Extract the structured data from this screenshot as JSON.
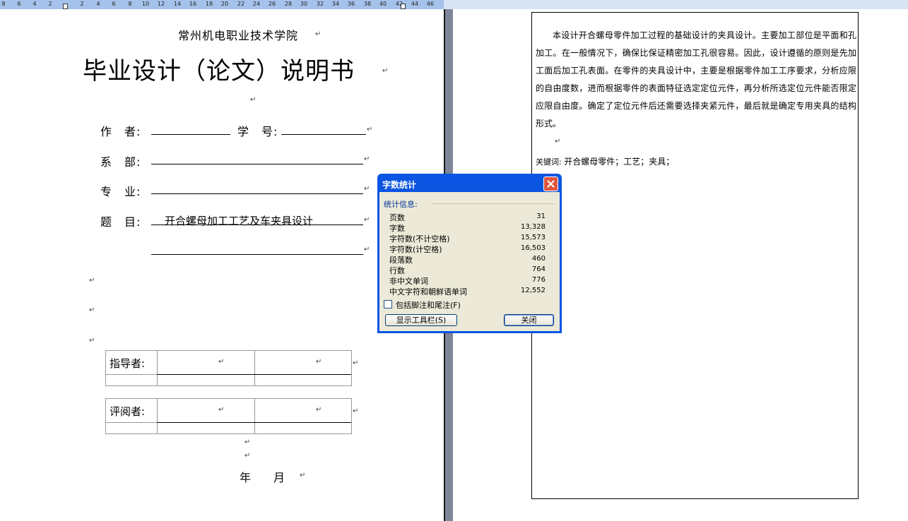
{
  "ruler": {
    "ticks": [
      "8",
      "6",
      "4",
      "2",
      "2",
      "4",
      "6",
      "8",
      "10",
      "12",
      "14",
      "16",
      "18",
      "20",
      "22",
      "24",
      "26",
      "28",
      "30",
      "32",
      "34",
      "36",
      "38",
      "40",
      "42",
      "44",
      "46"
    ]
  },
  "doc_left": {
    "college": "常州机电职业技术学院",
    "title": "毕业设计（论文）说明书",
    "para_mark": "↵",
    "author_label": "作　者:",
    "student_no_label": "学　号:",
    "dept_label": "系　部:",
    "major_label": "专　业:",
    "topic_label": "题　目:",
    "topic_value": "开合螺母加工工艺及车夹具设计",
    "advisor_label": "指导者:",
    "reviewer_label": "评阅者:",
    "date_text": "年　　月"
  },
  "doc_right": {
    "abstract": "本设计开合螺母零件加工过程的基础设计的夹具设计。主要加工部位是平面和孔加工。在一般情况下，确保比保证精密加工孔很容易。因此，设计遵循的原则是先加工面后加工孔表面。在零件的夹具设计中，主要是根据零件加工工序要求，分析应限的自由度数，进而根据零件的表面特征选定定位元件，再分析所选定位元件能否限定应限自由度。确定了定位元件后还需要选择夹紧元件，最后就是确定专用夹具的结构形式。",
    "keywords_label": "关键词:",
    "keywords": "开合螺母零件；工艺；夹具；"
  },
  "dialog": {
    "title": "字数统计",
    "section": "统计信息:",
    "stats": [
      {
        "name": "页数",
        "value": "31"
      },
      {
        "name": "字数",
        "value": "13,328"
      },
      {
        "name": "字符数(不计空格)",
        "value": "15,573"
      },
      {
        "name": "字符数(计空格)",
        "value": "16,503"
      },
      {
        "name": "段落数",
        "value": "460"
      },
      {
        "name": "行数",
        "value": "764"
      },
      {
        "name": "非中文单词",
        "value": "776"
      },
      {
        "name": "中文字符和朝鲜语单词",
        "value": "12,552"
      }
    ],
    "checkbox_label": "包括脚注和尾注(F)",
    "toolbar_button": "显示工具栏(S)",
    "close_button": "关闭"
  },
  "colors": {
    "titlebar": "#0b55e2",
    "dialog_body": "#ece9d8",
    "close": "#e0573f"
  }
}
